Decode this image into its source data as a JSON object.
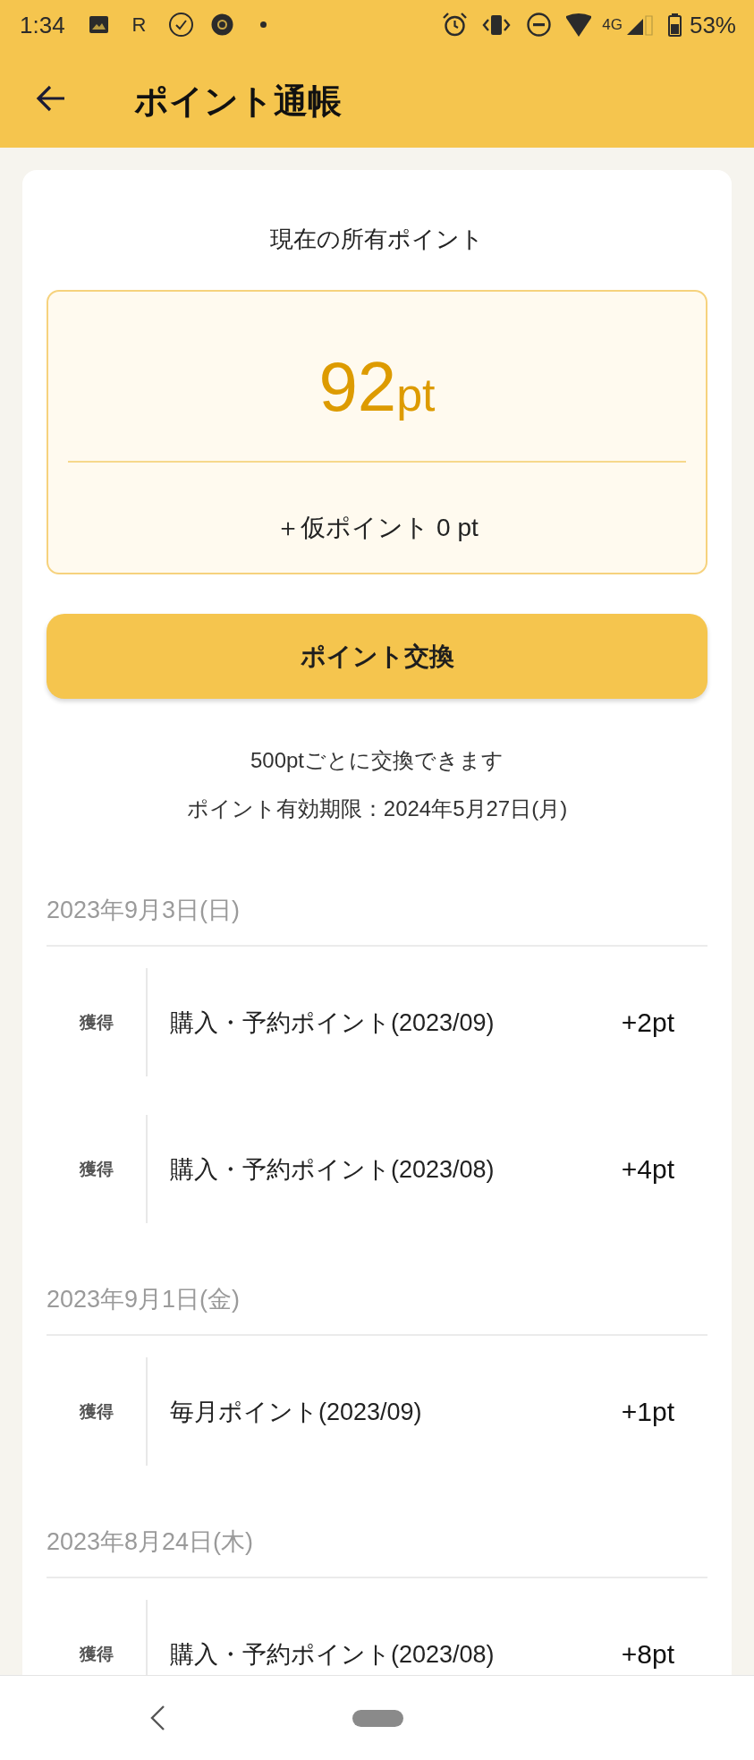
{
  "status_bar": {
    "time": "1:34",
    "app_letter": "R",
    "network": "4G",
    "battery": "53%"
  },
  "header": {
    "title": "ポイント通帳"
  },
  "balance": {
    "label": "現在の所有ポイント",
    "amount": "92",
    "unit": "pt",
    "provisional": "＋仮ポイント 0 pt"
  },
  "exchange_button": {
    "label": "ポイント交換"
  },
  "notes": [
    "500ptごとに交換できます",
    "ポイント有効期限：2024年5月27日(月)"
  ],
  "history": [
    {
      "date": "2023年9月3日(日)",
      "entries": [
        {
          "type": "獲得",
          "description": "購入・予約ポイント(2023/09)",
          "points": "+2pt"
        },
        {
          "type": "獲得",
          "description": "購入・予約ポイント(2023/08)",
          "points": "+4pt"
        }
      ]
    },
    {
      "date": "2023年9月1日(金)",
      "entries": [
        {
          "type": "獲得",
          "description": "毎月ポイント(2023/09)",
          "points": "+1pt"
        }
      ]
    },
    {
      "date": "2023年8月24日(木)",
      "entries": [
        {
          "type": "獲得",
          "description": "購入・予約ポイント(2023/08)",
          "points": "+8pt"
        }
      ]
    }
  ]
}
